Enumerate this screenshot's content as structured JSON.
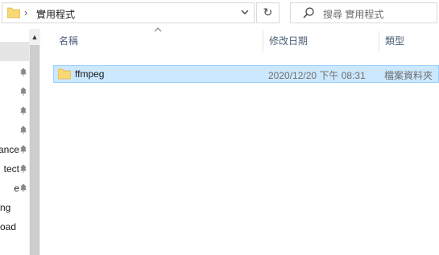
{
  "address_bar": {
    "path_label": "實用程式",
    "folder_icon": "folder-icon",
    "dropdown_icon": "chevron-down-icon"
  },
  "refresh": {
    "icon": "refresh-icon",
    "glyph": "↻"
  },
  "search": {
    "placeholder": "搜尋 實用程式",
    "icon": "search-icon"
  },
  "nav_pane": {
    "items": [
      {
        "label": "",
        "pinned": true
      },
      {
        "label": "",
        "pinned": true
      },
      {
        "label": "",
        "pinned": true
      },
      {
        "label": "",
        "pinned": true
      },
      {
        "label": "ance",
        "pinned": true
      },
      {
        "label": "tect",
        "pinned": true
      },
      {
        "label": "e",
        "pinned": true
      },
      {
        "label": "ng",
        "pinned": false
      },
      {
        "label": "oad",
        "pinned": false
      }
    ]
  },
  "columns": {
    "name": "名稱",
    "date": "修改日期",
    "type": "類型"
  },
  "files": [
    {
      "name": "ffmpeg",
      "modified": "2020/12/20 下午 08:31",
      "type": "檔案資料夾"
    }
  ],
  "colors": {
    "selection_bg": "#cce8ff",
    "selection_border": "#99d1ff",
    "folder": "#f8d775"
  }
}
